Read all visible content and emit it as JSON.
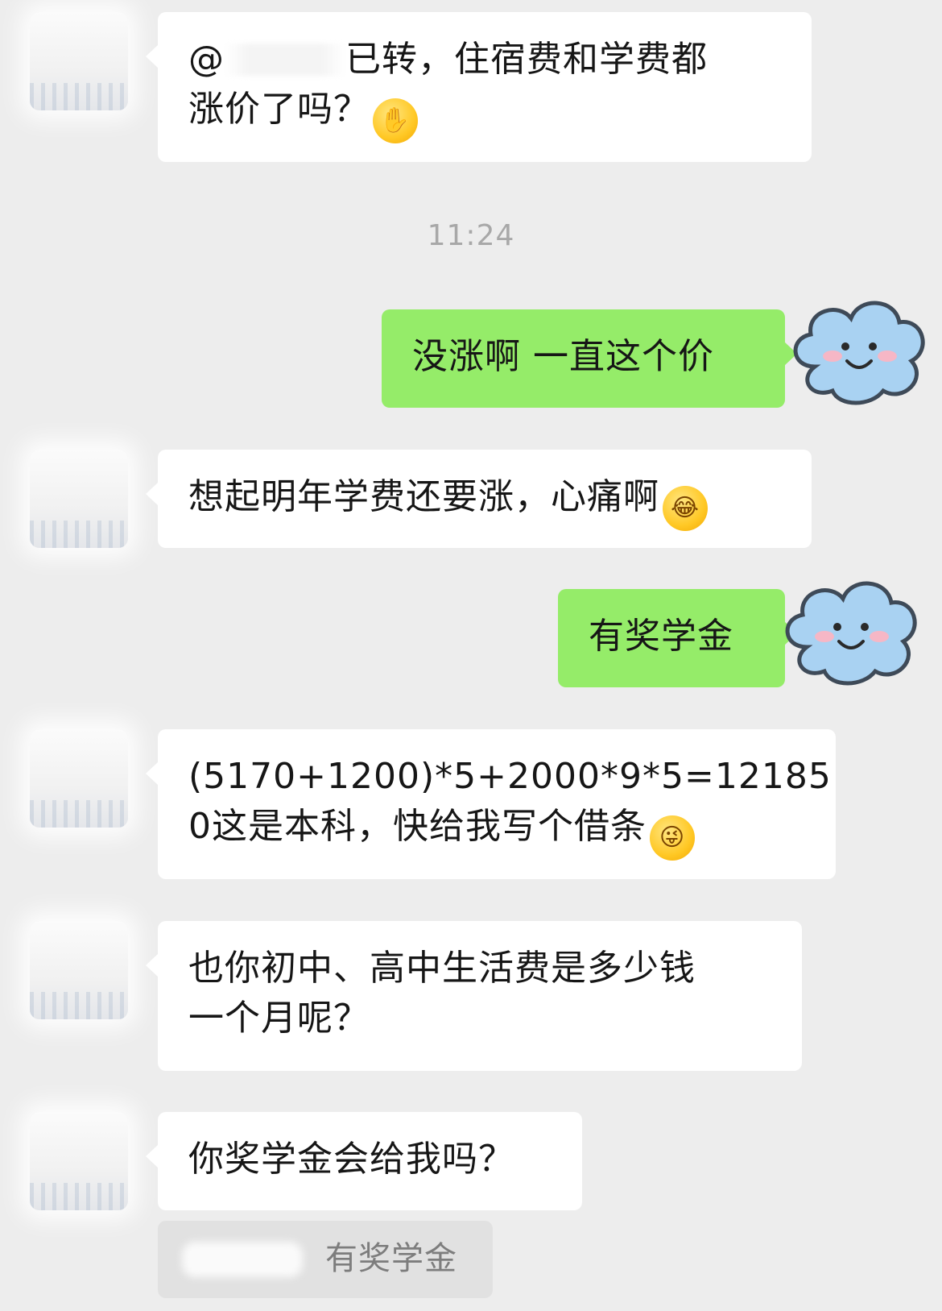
{
  "messages": [
    {
      "id": "m1",
      "side": "in",
      "text_parts": [
        "@",
        "已转，住宿费和学费都",
        "涨价了吗？"
      ],
      "emoji": "hand-over-mouth-emoji"
    },
    {
      "id": "m2",
      "side": "out",
      "text": "没涨啊 一直这个价"
    },
    {
      "id": "m3",
      "side": "in",
      "text": "想起明年学费还要涨，心痛啊",
      "emoji": "rolling-laughing-emoji"
    },
    {
      "id": "m4",
      "side": "out",
      "text": "有奖学金"
    },
    {
      "id": "m5",
      "side": "in",
      "line1": "(5170+1200)*5+2000*9*5=12185",
      "line2": "0这是本科，快给我写个借条",
      "emoji": "winking-tongue-emoji"
    },
    {
      "id": "m6",
      "side": "in",
      "line1": "也你初中、高中生活费是多少钱",
      "line2": "一个月呢？"
    },
    {
      "id": "m7",
      "side": "in",
      "text": "你奖学金会给我吗？"
    }
  ],
  "timestamp": "11:24",
  "quote": {
    "text": "有奖学金"
  },
  "colors": {
    "background": "#ededed",
    "incoming": "#ffffff",
    "outgoing": "#95ec69",
    "timestamp": "#a8a8a8"
  }
}
